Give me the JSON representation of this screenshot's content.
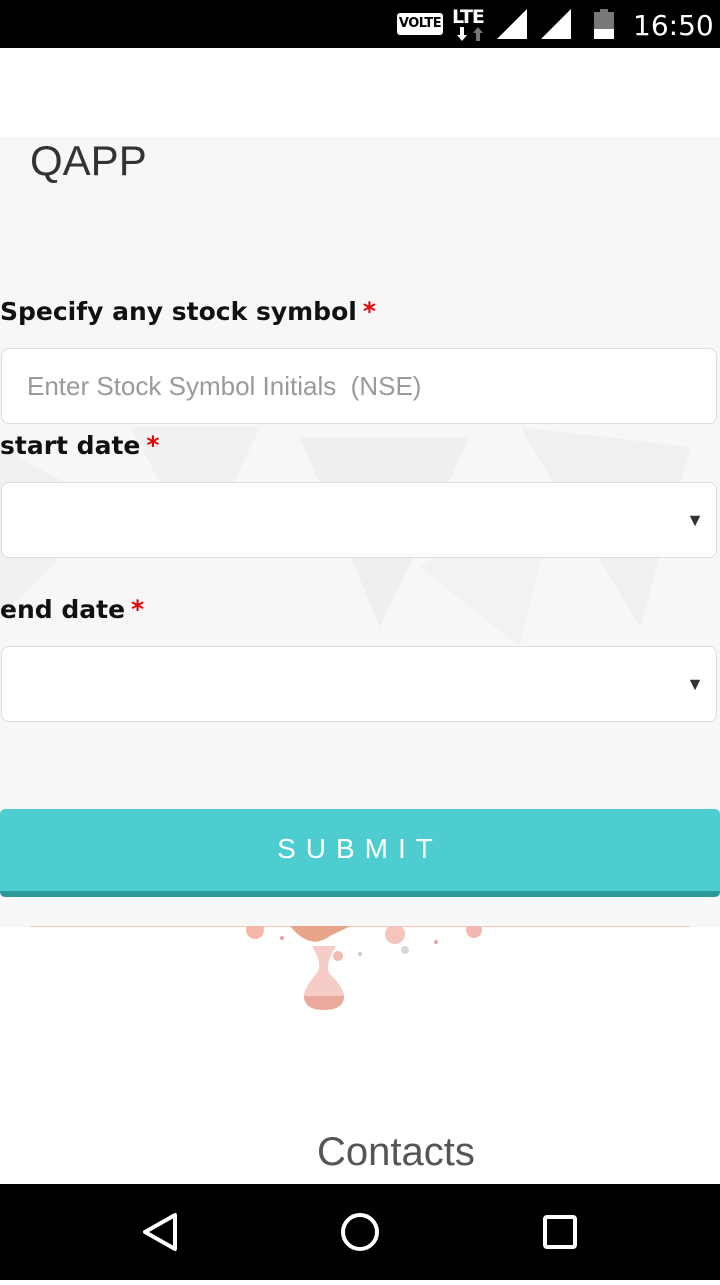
{
  "status_bar": {
    "volte": "VOLTE",
    "network": "LTE",
    "time": "16:50"
  },
  "app": {
    "title": "QAPP"
  },
  "form": {
    "symbol_label": "Specify any stock symbol",
    "symbol_placeholder": "Enter Stock Symbol Initials  (NSE)",
    "symbol_value": "",
    "start_label": "start date",
    "start_value": "",
    "end_label": "end date",
    "end_value": "",
    "required_marker": "*",
    "dropdown_caret": "▼",
    "submit_label": "SUBMIT"
  },
  "footer": {
    "contacts_heading": "Contacts"
  },
  "colors": {
    "accent": "#4ecdd1",
    "accent_dark": "#2d9a9a",
    "required": "#e60000",
    "panel_bg": "#f7f7f7"
  },
  "icons": {
    "status": [
      "signal-icon",
      "signal-icon",
      "battery-icon"
    ],
    "nav": [
      "back-icon",
      "home-icon",
      "recents-icon"
    ]
  }
}
